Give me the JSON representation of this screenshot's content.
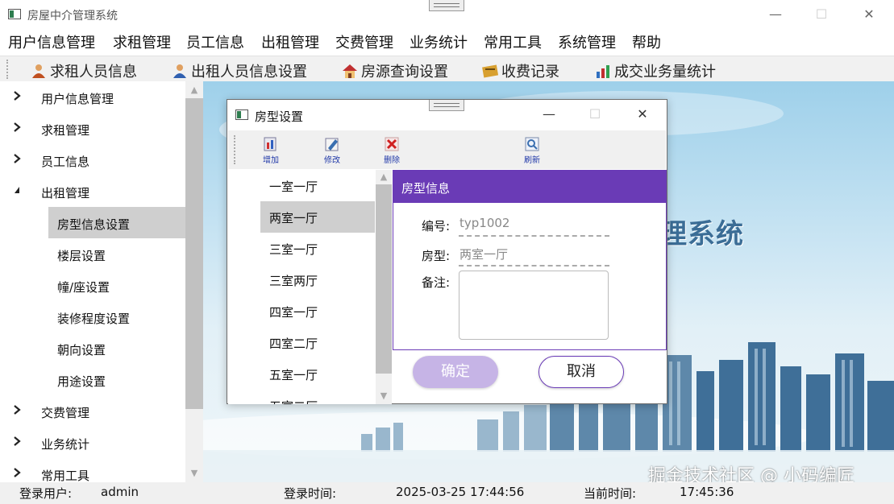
{
  "app": {
    "title": "房屋中介管理系统",
    "minimize_glyph": "—",
    "maximize_glyph": "☐",
    "close_glyph": "✕"
  },
  "menubar": {
    "items": [
      "用户信息管理",
      "求租管理",
      "员工信息",
      "出租管理",
      "交费管理",
      "业务统计",
      "常用工具",
      "系统管理",
      "帮助"
    ]
  },
  "toolbar": {
    "items": [
      {
        "label": "求租人员信息",
        "icon": "person-icon"
      },
      {
        "label": "出租人员信息设置",
        "icon": "person-icon"
      },
      {
        "label": "房源查询设置",
        "icon": "house-icon"
      },
      {
        "label": "收费记录",
        "icon": "ledger-icon"
      },
      {
        "label": "成交业务量统计",
        "icon": "bar-chart-icon"
      }
    ]
  },
  "nav": {
    "groups": [
      "用户信息管理",
      "求租管理",
      "员工信息",
      "出租管理"
    ],
    "children": [
      "房型信息设置",
      "楼层设置",
      "幢/座设置",
      "装修程度设置",
      "朝向设置",
      "用途设置"
    ],
    "groups_after": [
      "交费管理",
      "业务统计",
      "常用工具"
    ],
    "selected": "房型信息设置"
  },
  "background": {
    "banner_text": "理系统",
    "watermark": "掘金技术社区 @ 小码编匠"
  },
  "status": {
    "login_user_label": "登录用户:",
    "login_user": "admin",
    "login_time_label": "登录时间:",
    "login_time": "2025-03-25 17:44:56",
    "current_time_label": "当前时间:",
    "current_time": "17:45:36"
  },
  "dialog": {
    "title": "房型设置",
    "toolbar": {
      "add": "增加",
      "edit": "修改",
      "delete": "删除",
      "refresh": "刷新"
    },
    "room_types": [
      "一室一厅",
      "两室一厅",
      "三室一厅",
      "三室两厅",
      "四室一厅",
      "四室二厅",
      "五室一厅",
      "五室二厅"
    ],
    "selected": "两室一厅",
    "panel": {
      "title": "房型信息",
      "id_label": "编号:",
      "id_value": "typ1002",
      "type_label": "房型:",
      "type_value": "两室一厅",
      "remark_label": "备注:",
      "remark_value": ""
    },
    "ok_button": "确定",
    "cancel_button": "取消"
  },
  "colors": {
    "accent": "#6a3bb6",
    "ok_disabled": "#c6b4e6",
    "selection": "#cfcfcf"
  }
}
